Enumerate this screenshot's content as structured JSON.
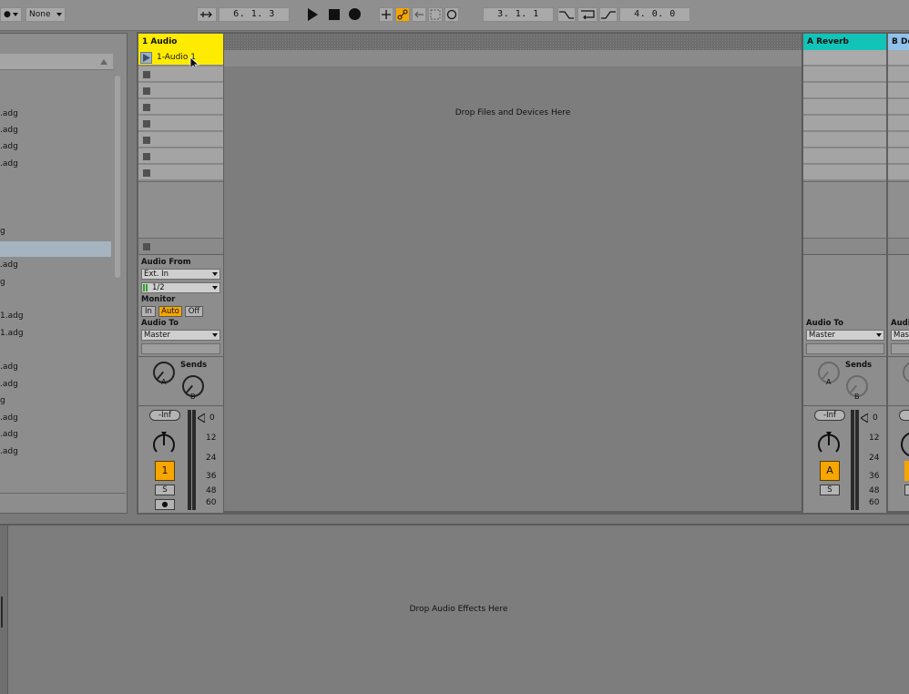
{
  "transport": {
    "keys_dot": "●",
    "midi_dropdown": "None",
    "arrangement_position": "6.   1.   3",
    "loop_start": "3.   1.   1",
    "loop_length": "4.   0.   0"
  },
  "icons": {
    "follow": "follow-icon",
    "play": "play-icon",
    "stop": "stop-icon",
    "record": "record-icon",
    "overdub": "overdub-icon",
    "automation_arm": "automation-arm-icon",
    "back_to_arrangement": "back-to-arrangement-icon",
    "capture": "capture-icon",
    "session_record": "session-record-icon",
    "punch_in": "punch-in-icon",
    "loop": "loop-icon",
    "punch_out": "punch-out-icon"
  },
  "browser": {
    "items": [
      ".adg",
      ".adg",
      ".adg",
      ".adg",
      "g",
      "",
      ".adg",
      "g",
      "1.adg",
      "1.adg",
      ".adg",
      ".adg",
      "g",
      ".adg",
      ".adg",
      ".adg"
    ]
  },
  "tracks": {
    "audio": {
      "title": "1 Audio",
      "clip_name": "1-Audio 1",
      "audio_from_label": "Audio From",
      "audio_from_value": "Ext. In",
      "channel_value": "1/2",
      "monitor_label": "Monitor",
      "monitor_in": "In",
      "monitor_auto": "Auto",
      "monitor_off": "Off",
      "audio_to_label": "Audio To",
      "audio_to_value": "Master",
      "sends_label": "Sends",
      "send_a": "A",
      "send_b": "B",
      "volume": "-Inf",
      "activator": "1",
      "solo": "S",
      "arm": "●",
      "color": "#ffeb00"
    },
    "return_a": {
      "title": "A Reverb",
      "audio_to_label": "Audio To",
      "audio_to_value": "Master",
      "sends_label": "Sends",
      "send_a": "A",
      "send_b": "B",
      "volume": "-Inf",
      "activator": "A",
      "solo": "S",
      "color": "#12c4b8"
    },
    "return_b": {
      "title": "B De",
      "audio_to_label": "Audi",
      "audio_to_value": "Mas",
      "volume": "-",
      "color": "#8fc1ea"
    }
  },
  "meter_scale": [
    "0",
    "12",
    "24",
    "36",
    "48",
    "60"
  ],
  "drop_zone": "Drop Files and Devices Here",
  "device_drop": "Drop Audio Effects Here"
}
